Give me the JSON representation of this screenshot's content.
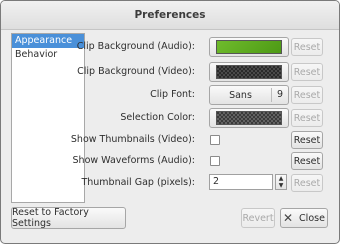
{
  "window": {
    "title": "Preferences"
  },
  "sidebar": {
    "items": [
      {
        "label": "Appearance",
        "selected": true
      },
      {
        "label": "Behavior",
        "selected": false
      }
    ]
  },
  "rows": {
    "clip_bg_audio": {
      "label": "Clip Background (Audio):",
      "reset": "Reset"
    },
    "clip_bg_video": {
      "label": "Clip Background (Video):",
      "reset": "Reset"
    },
    "clip_font": {
      "label": "Clip Font:",
      "font_name": "Sans",
      "font_size": "9",
      "reset": "Reset"
    },
    "selection_color": {
      "label": "Selection Color:",
      "reset": "Reset"
    },
    "show_thumbnails": {
      "label": "Show Thumbnails (Video):",
      "reset": "Reset",
      "checked": false
    },
    "show_waveforms": {
      "label": "Show Waveforms (Audio):",
      "reset": "Reset",
      "checked": false
    },
    "thumbnail_gap": {
      "label": "Thumbnail Gap (pixels):",
      "value": "2",
      "reset": "Reset"
    }
  },
  "footer": {
    "factory_label": "Reset to Factory Settings",
    "revert_label": "Revert",
    "close_label": "Close"
  },
  "icons": {
    "close": "close-icon",
    "spin_up": "spin-up-icon",
    "spin_down": "spin-down-icon"
  },
  "colors": {
    "audio_bg": "#5fa823",
    "selection": "#4a90d9"
  }
}
